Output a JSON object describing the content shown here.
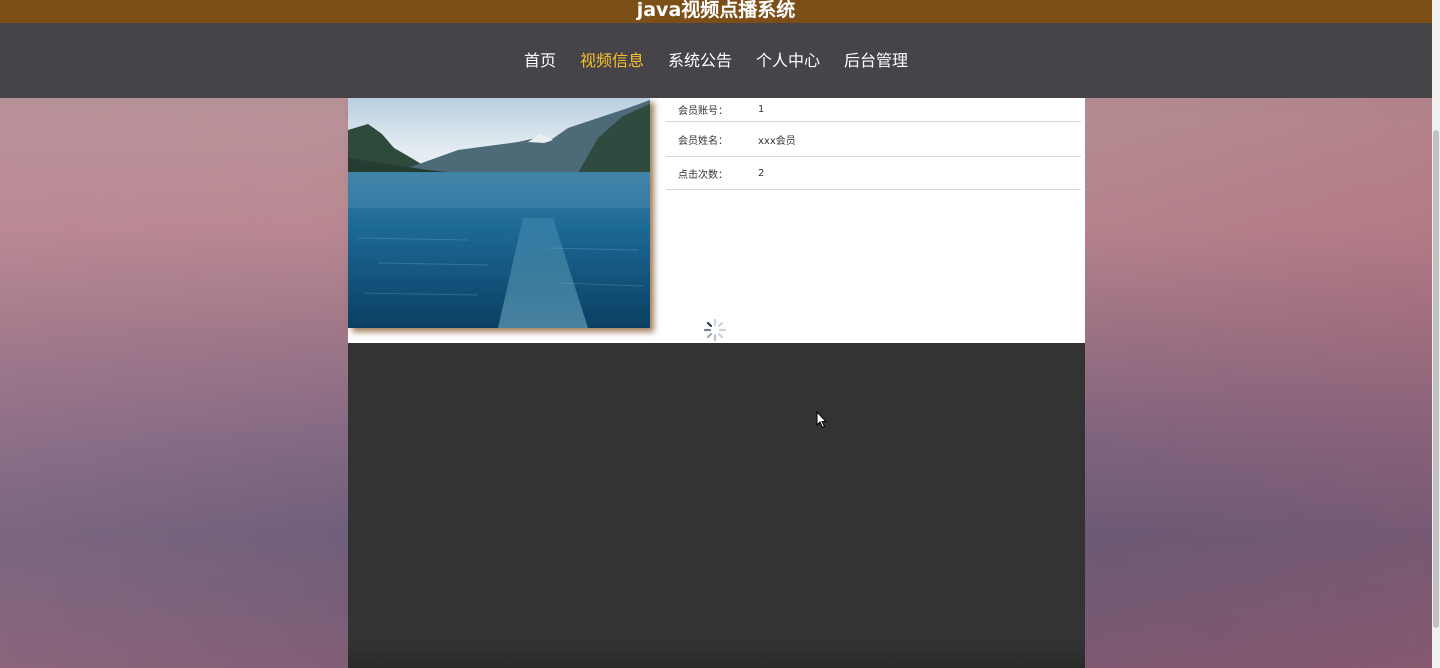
{
  "header": {
    "title": "java视频点播系统"
  },
  "nav": {
    "items": [
      {
        "label": "首页"
      },
      {
        "label": "视频信息",
        "active": true
      },
      {
        "label": "系统公告"
      },
      {
        "label": "个人中心"
      },
      {
        "label": "后台管理"
      }
    ]
  },
  "video_info": {
    "rows": [
      {
        "label": "会员账号：",
        "value": "1"
      },
      {
        "label": "会员姓名：",
        "value": "xxx会员"
      },
      {
        "label": "点击次数：",
        "value": "2"
      }
    ]
  },
  "colors": {
    "title_bar": "#7c4f18",
    "nav_bg": "#474449",
    "nav_active": "#f5c02b",
    "video_bg": "#333333"
  },
  "icons": {
    "spinner": "loading-spinner-icon",
    "cursor": "mouse-cursor-icon"
  }
}
